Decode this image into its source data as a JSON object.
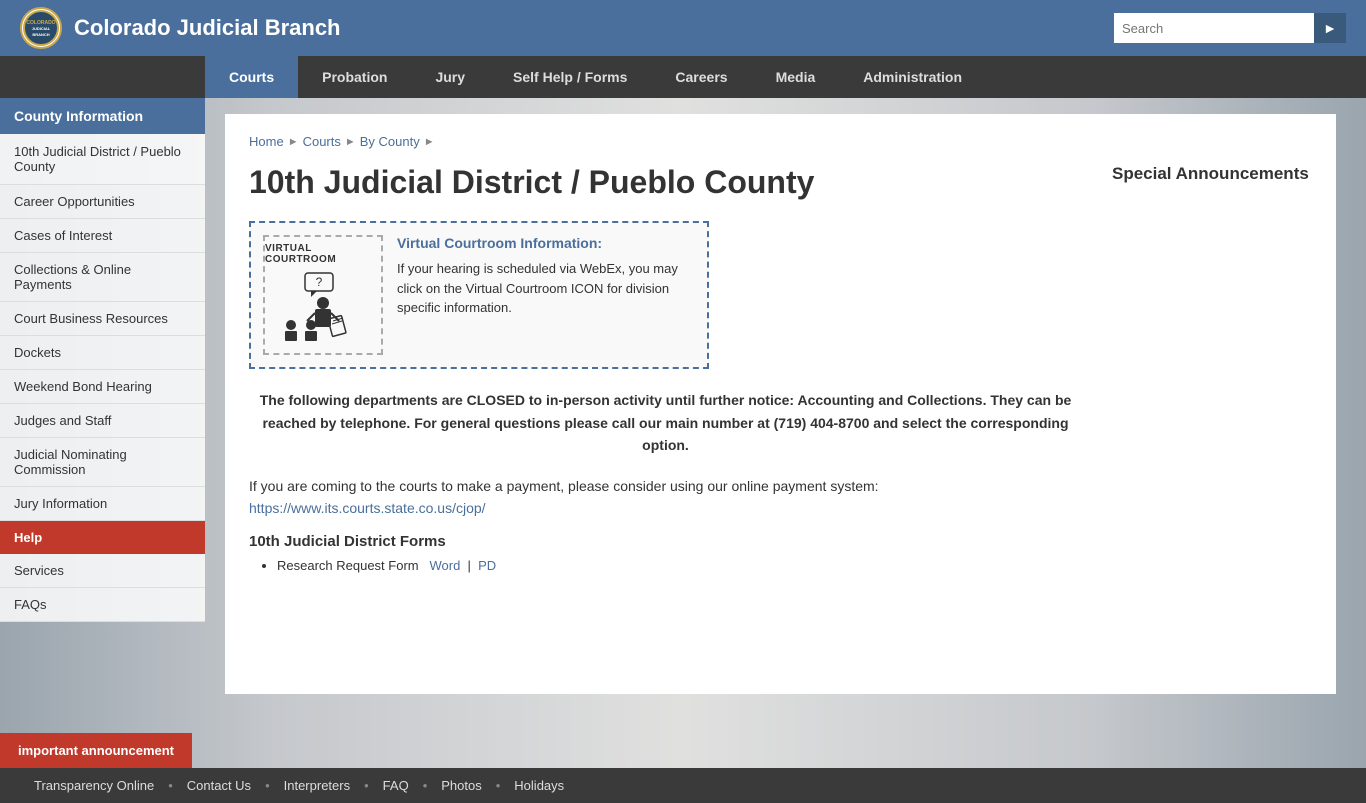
{
  "header": {
    "logo_alt": "Colorado Judicial Branch Logo",
    "site_title": "Colorado Judicial Branch",
    "search_placeholder": "Search"
  },
  "nav": {
    "items": [
      {
        "label": "Courts",
        "active": true
      },
      {
        "label": "Probation",
        "active": false
      },
      {
        "label": "Jury",
        "active": false
      },
      {
        "label": "Self Help / Forms",
        "active": false
      },
      {
        "label": "Careers",
        "active": false
      },
      {
        "label": "Media",
        "active": false
      },
      {
        "label": "Administration",
        "active": false
      }
    ]
  },
  "sidebar": {
    "county_info_label": "County Information",
    "first_link": "10th Judicial District / Pueblo County",
    "links": [
      {
        "label": "Career Opportunities"
      },
      {
        "label": "Cases of Interest"
      },
      {
        "label": "Collections & Online Payments"
      },
      {
        "label": "Court Business Resources"
      },
      {
        "label": "Dockets"
      },
      {
        "label": "Weekend Bond Hearing"
      },
      {
        "label": "Judges and Staff"
      },
      {
        "label": "Judicial Nominating Commission"
      },
      {
        "label": "Jury Information"
      }
    ],
    "help_label": "Help",
    "help_links": [
      {
        "label": "Services"
      },
      {
        "label": "FAQs"
      }
    ]
  },
  "breadcrumb": {
    "items": [
      "Home",
      "Courts",
      "By County"
    ]
  },
  "main": {
    "page_title": "10th Judicial District / Pueblo County",
    "announcements_heading": "Special Announcements",
    "virtual_courtroom": {
      "label": "VIRTUAL COURTROOM",
      "heading": "Virtual Courtroom Information:",
      "body": "If your hearing is scheduled via WebEx, you may click on the Virtual Courtroom ICON for division specific information."
    },
    "notice_text": "The following departments are CLOSED to in-person activity until further notice: Accounting and Collections. They can be reached by telephone. For general questions please call our main number at (719) 404-8700 and select the corresponding option.",
    "payment_text": "If you are coming to the courts to make a payment, please consider using our online payment system:",
    "payment_link": "https://www.its.courts.state.co.us/cjop/",
    "forms_heading": "10th Judicial District Forms",
    "forms": [
      {
        "label": "Research Request Form",
        "links": [
          {
            "text": "Word",
            "href": "#"
          },
          {
            "text": "PD",
            "href": "#"
          }
        ]
      }
    ]
  },
  "footer": {
    "items": [
      "Transparency Online",
      "Contact Us",
      "Interpreters",
      "FAQ",
      "Photos",
      "Holidays"
    ]
  },
  "important_banner": {
    "label": "important announcement"
  }
}
